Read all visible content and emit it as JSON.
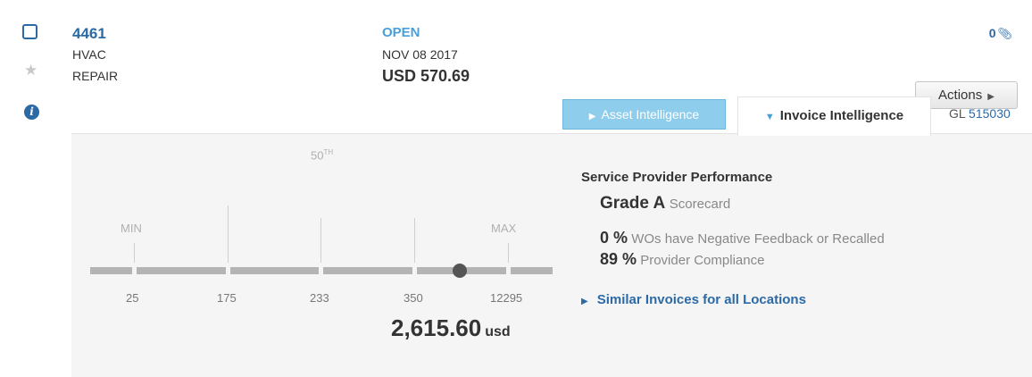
{
  "work_order": {
    "number": "4461",
    "trade": "HVAC",
    "category": "REPAIR",
    "status": "OPEN",
    "date": "NOV 08 2017",
    "amount": "USD 570.69"
  },
  "attachments": {
    "count": "0",
    "icon": "paperclip-icon"
  },
  "actions": {
    "label": "Actions",
    "icon": "caret-right-icon"
  },
  "tabs": [
    {
      "label": "Asset Intelligence",
      "active": false
    },
    {
      "label": "Invoice Intelligence",
      "active": true
    }
  ],
  "gl": {
    "prefix": "GL",
    "code": "515030"
  },
  "invoice_range": {
    "percentile_label": "50",
    "percentile_suffix": "TH",
    "min_label": "MIN",
    "max_label": "MAX",
    "ticks": [
      "25",
      "175",
      "233",
      "350",
      "12295"
    ],
    "current_amount": "2,615.60",
    "current_unit": "usd"
  },
  "provider_performance": {
    "title": "Service Provider Performance",
    "grade": "Grade A",
    "grade_suffix": "Scorecard",
    "negative_pct": "0 %",
    "negative_text": "WOs have Negative Feedback or Recalled",
    "compliance_pct": "89 %",
    "compliance_text": "Provider Compliance"
  },
  "similar_link": "Similar Invoices for all Locations",
  "colors": {
    "link": "#2c6aa6",
    "status": "#4a9fd8",
    "tab_inactive": "#8fcdec"
  }
}
